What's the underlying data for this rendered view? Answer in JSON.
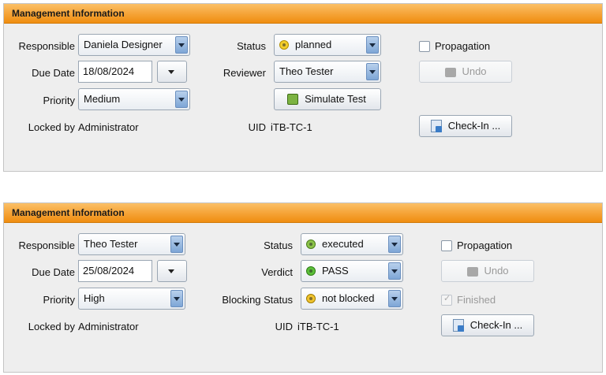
{
  "panels": [
    {
      "title": "Management Information",
      "responsible": {
        "label": "Responsible",
        "value": "Daniela Designer"
      },
      "due_date": {
        "label": "Due Date",
        "value": "18/08/2024"
      },
      "priority": {
        "label": "Priority",
        "value": "Medium"
      },
      "locked_by": {
        "label": "Locked by",
        "value": "Administrator"
      },
      "status": {
        "label": "Status",
        "value": "planned",
        "icon": "planned-status-icon",
        "color": "#f2cd2c"
      },
      "reviewer": {
        "label": "Reviewer",
        "value": "Theo Tester"
      },
      "simulate_button": "Simulate Test",
      "uid": {
        "label": "UID",
        "value": "iTB-TC-1"
      },
      "propagation_label": "Propagation",
      "undo_label": "Undo",
      "checkin_label": "Check-In ..."
    },
    {
      "title": "Management Information",
      "responsible": {
        "label": "Responsible",
        "value": "Theo Tester"
      },
      "due_date": {
        "label": "Due Date",
        "value": "25/08/2024"
      },
      "priority": {
        "label": "Priority",
        "value": "High"
      },
      "locked_by": {
        "label": "Locked by",
        "value": "Administrator"
      },
      "status": {
        "label": "Status",
        "value": "executed",
        "icon": "executed-status-icon",
        "color": "#8bc34a"
      },
      "verdict": {
        "label": "Verdict",
        "value": "PASS",
        "icon": "pass-verdict-icon",
        "color": "#5bbf3a"
      },
      "blocking_status": {
        "label": "Blocking Status",
        "value": "not blocked",
        "icon": "not-blocked-icon",
        "color": "#f0c430"
      },
      "uid": {
        "label": "UID",
        "value": "iTB-TC-1"
      },
      "propagation_label": "Propagation",
      "undo_label": "Undo",
      "finished_label": "Finished",
      "checkin_label": "Check-In ..."
    }
  ],
  "colors": {
    "header_orange": "#f5a235",
    "panel_bg": "#eeeeee"
  }
}
